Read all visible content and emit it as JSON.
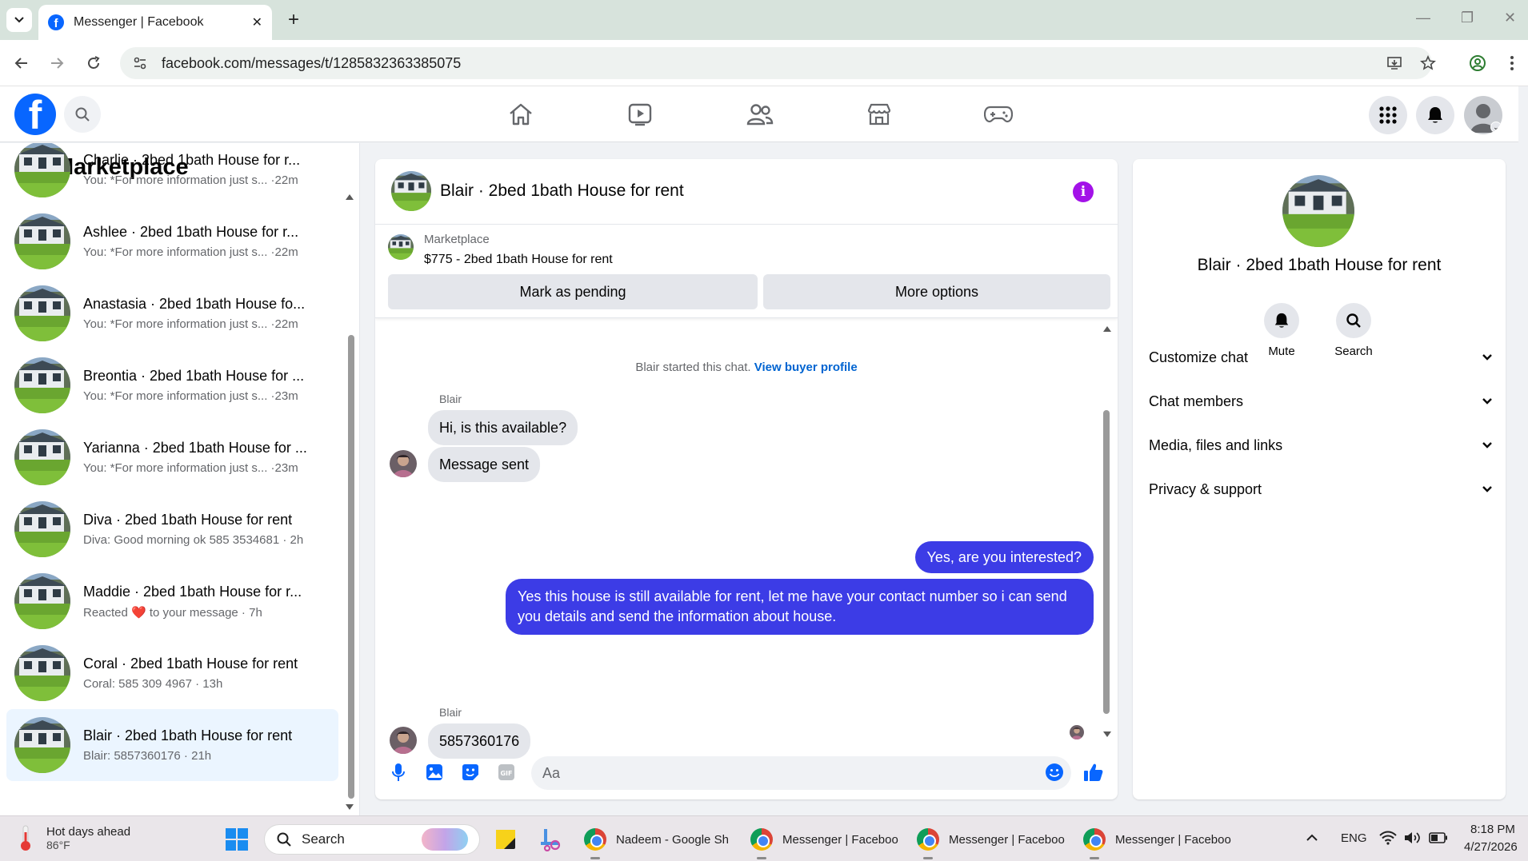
{
  "browser": {
    "tab_title": "Messenger | Facebook",
    "url": "facebook.com/messages/t/1285832363385075"
  },
  "left_panel": {
    "title": "Marketplace",
    "conversations": [
      {
        "name": "Charlie · 2bed 1bath House for r...",
        "preview": "You: *For more information just s... ·22m"
      },
      {
        "name": "Ashlee · 2bed 1bath House for r...",
        "preview": "You: *For more information just s... ·22m"
      },
      {
        "name": "Anastasia · 2bed 1bath House fo...",
        "preview": "You: *For more information just s... ·22m"
      },
      {
        "name": "Breontia · 2bed 1bath House for ...",
        "preview": "You: *For more information just s... ·23m"
      },
      {
        "name": "Yarianna · 2bed 1bath House for ...",
        "preview": "You: *For more information just s... ·23m"
      },
      {
        "name": "Diva · 2bed 1bath House for rent",
        "preview": "Diva: Good morning ok 585 3534681 · 2h"
      },
      {
        "name": "Maddie · 2bed 1bath House for r...",
        "preview": "Reacted ❤️ to your message · 7h"
      },
      {
        "name": "Coral · 2bed 1bath House for rent",
        "preview": "Coral: 585 309 4967 · 13h"
      },
      {
        "name": "Blair · 2bed 1bath House for rent",
        "preview": "Blair: 5857360176 · 21h"
      }
    ]
  },
  "chat": {
    "title": "Blair · 2bed 1bath House for rent",
    "listing_source": "Marketplace",
    "listing_price": "$775 - 2bed 1bath House for rent",
    "mark_pending_label": "Mark as pending",
    "more_options_label": "More options",
    "system_text": "Blair started this chat.",
    "system_link": "View buyer profile",
    "sender_name": "Blair",
    "msg_in_1": "Hi, is this available?",
    "msg_in_2": "Message sent",
    "msg_out_1": "Yes, are you interested?",
    "msg_out_2": "Yes this house is still available for rent, let me have your contact number so i can send you details and send the information about house.",
    "msg_in_3": "5857360176",
    "composer_placeholder": "Aa"
  },
  "info_panel": {
    "name": "Blair · 2bed 1bath House for rent",
    "mute_label": "Mute",
    "search_label": "Search",
    "sections": [
      "Customize chat",
      "Chat members",
      "Media, files and links",
      "Privacy & support"
    ]
  },
  "taskbar": {
    "weather_title": "Hot days ahead",
    "weather_temp": "86°F",
    "search_label": "Search",
    "apps": [
      "Nadeem - Google Sh",
      "Messenger | Faceboo",
      "Messenger | Faceboo",
      "Messenger | Faceboo"
    ],
    "language": "ENG",
    "time": "8:18 PM",
    "date": "4/27/2026"
  },
  "colors": {
    "facebook_blue": "#0866ff",
    "outgoing_bubble": "#3c3ce6",
    "info_purple": "#a312e8",
    "active_conversation": "#ebf5ff"
  }
}
